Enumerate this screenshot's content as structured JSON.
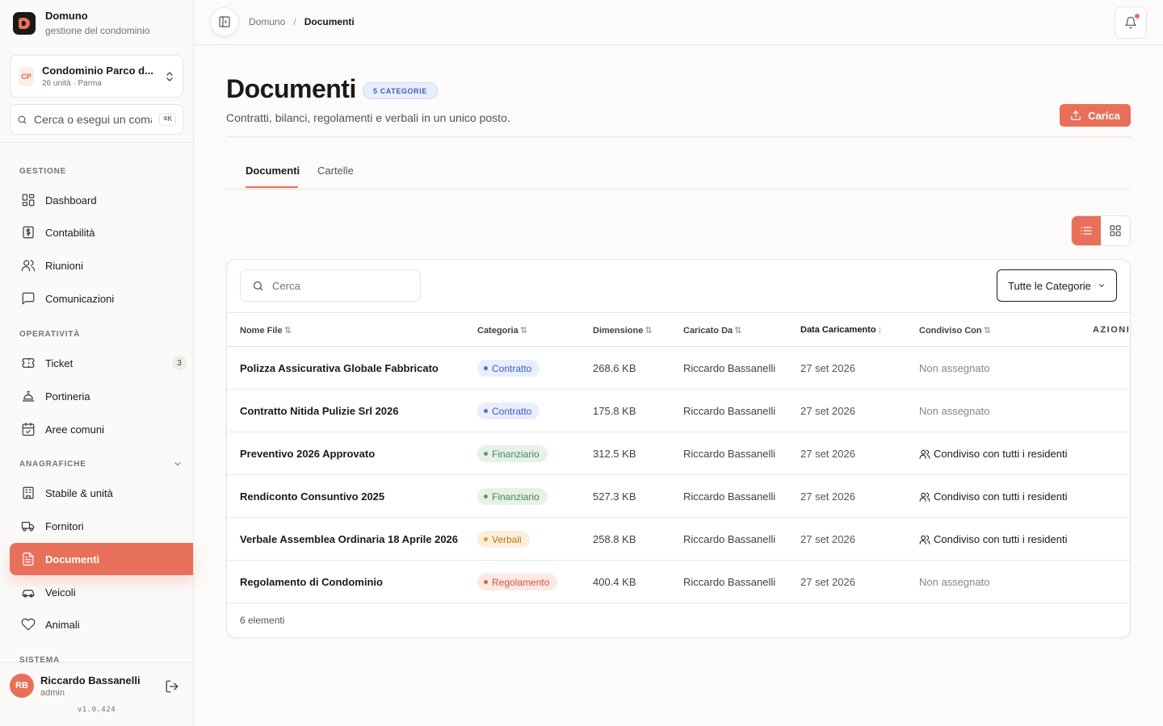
{
  "app": {
    "name": "Domuno",
    "subtitle": "gestione del condominio"
  },
  "building": {
    "initials": "CP",
    "name": "Condominio Parco d...",
    "meta": "26 unità · Parma"
  },
  "command": {
    "placeholder": "Cerca o esegui un comando",
    "shortcut": "⌘K"
  },
  "sidebar": {
    "sections": {
      "gestione": "GESTIONE",
      "operativita": "OPERATIVITÀ",
      "anagrafiche": "ANAGRAFICHE",
      "sistema": "SISTEMA"
    },
    "items": {
      "dashboard": "Dashboard",
      "contabilita": "Contabilità",
      "riunioni": "Riunioni",
      "comunicazioni": "Comunicazioni",
      "ticket": "Ticket",
      "ticket_count": "3",
      "portineria": "Portineria",
      "aree": "Aree comuni",
      "stabile": "Stabile & unità",
      "fornitori": "Fornitori",
      "documenti": "Documenti",
      "veicoli": "Veicoli",
      "animali": "Animali"
    }
  },
  "user": {
    "initials": "RB",
    "name": "Riccardo Bassanelli",
    "role": "admin",
    "version": "v1.0.424"
  },
  "breadcrumb": {
    "parent": "Domuno",
    "separator": "/",
    "current": "Documenti"
  },
  "page": {
    "title": "Documenti",
    "badge": "5 CATEGORIE",
    "subtitle": "Contratti, bilanci, regolamenti e verbali in un unico posto.",
    "upload_label": "Carica"
  },
  "tabs": {
    "documents": "Documenti",
    "folders": "Cartelle"
  },
  "table": {
    "search_placeholder": "Cerca",
    "filter_label": "Tutte le Categorie",
    "columns": {
      "name": "Nome File",
      "category": "Categoria",
      "size": "Dimensione",
      "uploaded_by": "Caricato Da",
      "date": "Data Caricamento",
      "shared": "Condiviso Con",
      "actions": "AZIONI"
    },
    "sort_icon": "⇅",
    "sorted_icon": "↓",
    "rows": [
      {
        "name": "Polizza Assicurativa Globale Fabbricato",
        "category": "Contratto",
        "size": "268.6 KB",
        "by": "Riccardo Bassanelli",
        "date": "27 set 2026",
        "shared": "Non assegnato"
      },
      {
        "name": "Contratto Nitida Pulizie Srl 2026",
        "category": "Contratto",
        "size": "175.8 KB",
        "by": "Riccardo Bassanelli",
        "date": "27 set 2026",
        "shared": "Non assegnato"
      },
      {
        "name": "Preventivo 2026 Approvato",
        "category": "Finanziario",
        "size": "312.5 KB",
        "by": "Riccardo Bassanelli",
        "date": "27 set 2026",
        "shared": "Condiviso con tutti i residenti"
      },
      {
        "name": "Rendiconto Consuntivo 2025",
        "category": "Finanziario",
        "size": "527.3 KB",
        "by": "Riccardo Bassanelli",
        "date": "27 set 2026",
        "shared": "Condiviso con tutti i residenti"
      },
      {
        "name": "Verbale Assemblea Ordinaria 18 Aprile 2026",
        "category": "Verbali",
        "size": "258.8 KB",
        "by": "Riccardo Bassanelli",
        "date": "27 set 2026",
        "shared": "Condiviso con tutti i residenti"
      },
      {
        "name": "Regolamento di Condominio",
        "category": "Regolamento",
        "size": "400.4 KB",
        "by": "Riccardo Bassanelli",
        "date": "27 set 2026",
        "shared": "Non assegnato"
      }
    ],
    "count_label": "6 elementi"
  },
  "colors": {
    "accent": "#e8705a",
    "contratto": "#4f6fd1",
    "finanziario": "#5e9a6a",
    "verbali": "#d99a2b",
    "regolamento": "#e0604a"
  }
}
